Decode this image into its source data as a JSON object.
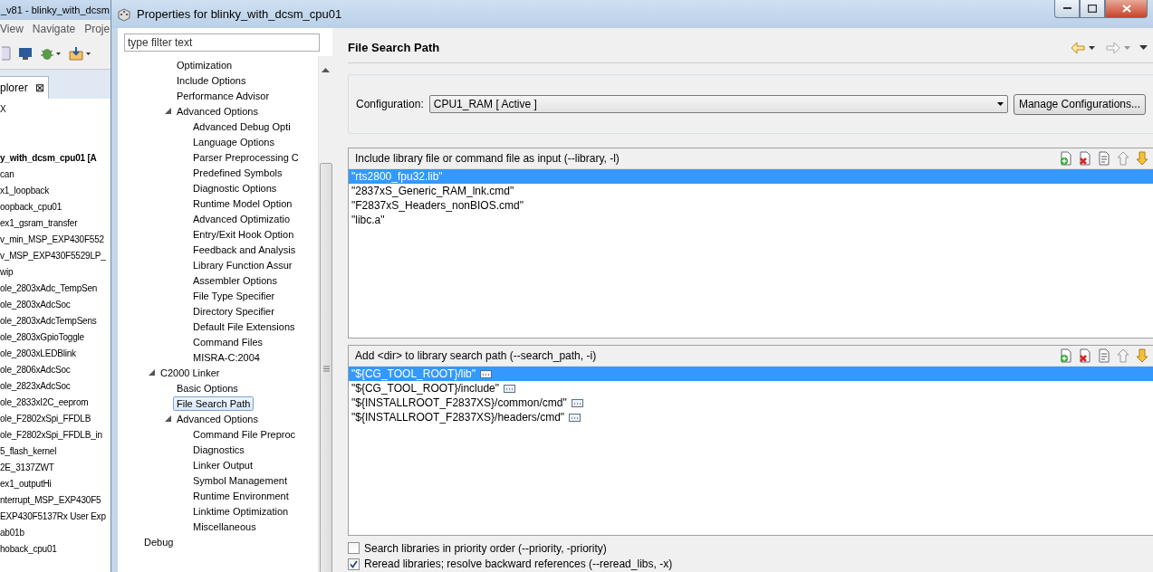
{
  "background_window": {
    "title": "_v81 - blinky_with_dcsm",
    "menu": [
      "View",
      "Navigate",
      "Proje"
    ],
    "explorer_tab": {
      "label": "plorer",
      "close": "⊠"
    },
    "explorer_items": [
      {
        "label": "X",
        "bold": false
      },
      {
        "label": "y_with_dcsm_cpu01  [A",
        "bold": true
      },
      {
        "label": "can",
        "bold": false
      },
      {
        "label": "x1_loopback",
        "bold": false
      },
      {
        "label": "oopback_cpu01",
        "bold": false
      },
      {
        "label": "ex1_gsram_transfer",
        "bold": false
      },
      {
        "label": "v_min_MSP_EXP430F552",
        "bold": false
      },
      {
        "label": "v_MSP_EXP430F5529LP_",
        "bold": false
      },
      {
        "label": "wip",
        "bold": false
      },
      {
        "label": "ole_2803xAdc_TempSen",
        "bold": false
      },
      {
        "label": "ole_2803xAdcSoc",
        "bold": false
      },
      {
        "label": "ole_2803xAdcTempSens",
        "bold": false
      },
      {
        "label": "ole_2803xGpioToggle",
        "bold": false
      },
      {
        "label": "ole_2803xLEDBlink",
        "bold": false
      },
      {
        "label": "ole_2806xAdcSoc",
        "bold": false
      },
      {
        "label": "ole_2823xAdcSoc",
        "bold": false
      },
      {
        "label": "ole_2833xI2C_eeprom",
        "bold": false
      },
      {
        "label": "ole_F2802xSpi_FFDLB",
        "bold": false
      },
      {
        "label": "ole_F2802xSpi_FFDLB_in",
        "bold": false
      },
      {
        "label": "5_flash_kernel",
        "bold": false
      },
      {
        "label": "2E_3137ZWT",
        "bold": false
      },
      {
        "label": "ex1_outputHi",
        "bold": false
      },
      {
        "label": "nterrupt_MSP_EXP430F5",
        "bold": false
      },
      {
        "label": "EXP430F5137Rx User Exp",
        "bold": false
      },
      {
        "label": "ab01b",
        "bold": false
      },
      {
        "label": "hoback_cpu01",
        "bold": false
      }
    ]
  },
  "dialog": {
    "title": "Properties for blinky_with_dcsm_cpu01",
    "filter": {
      "placeholder": "type filter text"
    },
    "tree": [
      {
        "children": [
          {
            "children": [
              {
                "label": "Optimization",
                "selected": false
              },
              {
                "label": "Include Options",
                "selected": false
              },
              {
                "label": "Performance Advisor",
                "selected": false
              },
              {
                "label": "Advanced Options",
                "selected": false,
                "expanded": true,
                "children": [
                  {
                    "label": "Advanced Debug Opti",
                    "selected": false
                  },
                  {
                    "label": "Language Options",
                    "selected": false
                  },
                  {
                    "label": "Parser Preprocessing C",
                    "selected": false
                  },
                  {
                    "label": "Predefined Symbols",
                    "selected": false
                  },
                  {
                    "label": "Diagnostic Options",
                    "selected": false
                  },
                  {
                    "label": "Runtime Model Option",
                    "selected": false
                  },
                  {
                    "label": "Advanced Optimizatio",
                    "selected": false
                  },
                  {
                    "label": "Entry/Exit Hook Option",
                    "selected": false
                  },
                  {
                    "label": "Feedback and Analysis",
                    "selected": false
                  },
                  {
                    "label": "Library Function Assur",
                    "selected": false
                  },
                  {
                    "label": "Assembler Options",
                    "selected": false
                  },
                  {
                    "label": "File Type Specifier",
                    "selected": false
                  },
                  {
                    "label": "Directory Specifier",
                    "selected": false
                  },
                  {
                    "label": "Default File Extensions",
                    "selected": false
                  },
                  {
                    "label": "Command Files",
                    "selected": false
                  },
                  {
                    "label": "MISRA-C:2004",
                    "selected": false
                  }
                ]
              }
            ]
          },
          {
            "label": "C2000 Linker",
            "selected": false,
            "expanded": true,
            "children": [
              {
                "label": "Basic Options",
                "selected": false
              },
              {
                "label": "File Search Path",
                "selected": true
              },
              {
                "label": "Advanced Options",
                "selected": false,
                "expanded": true,
                "children": [
                  {
                    "label": "Command File Preproc",
                    "selected": false
                  },
                  {
                    "label": "Diagnostics",
                    "selected": false
                  },
                  {
                    "label": "Linker Output",
                    "selected": false
                  },
                  {
                    "label": "Symbol Management",
                    "selected": false
                  },
                  {
                    "label": "Runtime Environment",
                    "selected": false
                  },
                  {
                    "label": "Linktime Optimization",
                    "selected": false
                  },
                  {
                    "label": "Miscellaneous",
                    "selected": false
                  }
                ]
              }
            ]
          }
        ]
      },
      {
        "label": "Debug",
        "selected": false
      }
    ],
    "page_title": "File Search Path",
    "configuration": {
      "label": "Configuration:",
      "value": "CPU1_RAM  [ Active ]",
      "button": "Manage Configurations..."
    },
    "lists": [
      {
        "title": "Include library file or command file as input (--library, -l)",
        "has_edit_button": false,
        "items": [
          {
            "text": "\"rts2800_fpu32.lib\"",
            "selected": true
          },
          {
            "text": "\"2837xS_Generic_RAM_lnk.cmd\"",
            "selected": false
          },
          {
            "text": "\"F2837xS_Headers_nonBIOS.cmd\"",
            "selected": false
          },
          {
            "text": "\"libc.a\"",
            "selected": false
          }
        ]
      },
      {
        "title": "Add <dir> to library search path (--search_path, -i)",
        "has_edit_button": true,
        "items": [
          {
            "text": "\"${CG_TOOL_ROOT}/lib\"",
            "selected": true
          },
          {
            "text": "\"${CG_TOOL_ROOT}/include\"",
            "selected": false
          },
          {
            "text": "\"${INSTALLROOT_F2837XS}/common/cmd\"",
            "selected": false
          },
          {
            "text": "\"${INSTALLROOT_F2837XS}/headers/cmd\"",
            "selected": false
          }
        ]
      }
    ],
    "options": [
      {
        "label": "Search libraries in priority order (--priority, -priority)",
        "checked": false
      },
      {
        "label": "Reread libraries; resolve backward references (--reread_libs, -x)",
        "checked": true
      }
    ]
  }
}
